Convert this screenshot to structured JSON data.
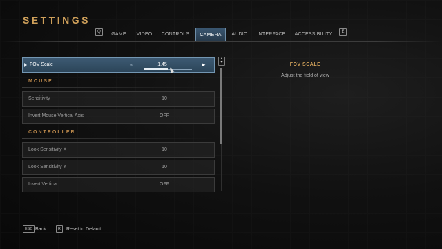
{
  "title": "SETTINGS",
  "tabs": {
    "prev_key": "Q",
    "next_key": "E",
    "items": [
      "GAME",
      "VIDEO",
      "CONTROLS",
      "CAMERA",
      "AUDIO",
      "INTERFACE",
      "ACCESSIBILITY"
    ],
    "active": "CAMERA"
  },
  "selected_setting": {
    "label": "FOV Scale",
    "value": "1.45",
    "slider_fraction": 0.5
  },
  "sections": {
    "mouse": "MOUSE",
    "controller": "CONTROLLER"
  },
  "mouse_settings": [
    {
      "label": "Sensitivity",
      "value": "10"
    },
    {
      "label": "Invert Mouse Vertical Axis",
      "value": "OFF"
    }
  ],
  "controller_settings": [
    {
      "label": "Look Sensitivity X",
      "value": "10"
    },
    {
      "label": "Look Sensitivity Y",
      "value": "10"
    },
    {
      "label": "Invert Vertical",
      "value": "OFF"
    }
  ],
  "detail": {
    "title": "FOV SCALE",
    "description": "Adjust the field of view"
  },
  "footer": {
    "back_key": "ESC",
    "back_label": "Back",
    "reset_key": "R",
    "reset_label": "Reset to Default"
  },
  "colors": {
    "accent": "#cfa05a",
    "selected_bg": "#3d5a73"
  }
}
